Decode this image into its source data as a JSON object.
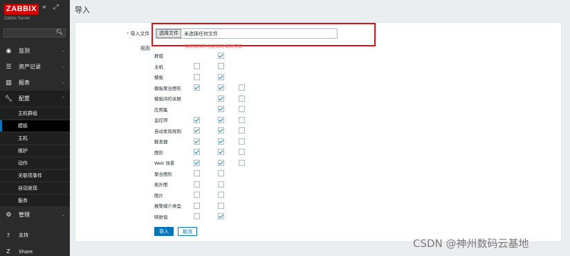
{
  "sidebar": {
    "logo": "ZABBIX",
    "collapse_icon": "«",
    "kiosk_icon": "⤢",
    "server_name": "Zabbix Server",
    "menu": [
      {
        "label": "监测",
        "icon": "eye-icon"
      },
      {
        "label": "资产记录",
        "icon": "list-icon"
      },
      {
        "label": "报表",
        "icon": "chart-icon"
      },
      {
        "label": "配置",
        "icon": "wrench-icon"
      }
    ],
    "submenu": [
      "主机群组",
      "模板",
      "主机",
      "维护",
      "动作",
      "关联项事件",
      "自动发现",
      "服务"
    ],
    "admin": {
      "label": "管理",
      "icon": "gear-icon"
    },
    "bottom": [
      {
        "label": "支持",
        "icon": "support-icon"
      },
      {
        "label": "Share",
        "icon": "share-icon"
      }
    ]
  },
  "page": {
    "title": "导入"
  },
  "form": {
    "import_file_label": "导入文件",
    "file_button": "选择文件",
    "file_status": "未选择任何文件",
    "rules_label": "规则",
    "column_headers": "更新现有的 创建新的 删除失败",
    "rules": [
      {
        "name": "群组",
        "cols": [
          null,
          true,
          null
        ]
      },
      {
        "name": "主机",
        "cols": [
          false,
          false,
          null
        ]
      },
      {
        "name": "模板",
        "cols": [
          false,
          true,
          null
        ]
      },
      {
        "name": "模板聚合图形",
        "cols": [
          true,
          true,
          false
        ]
      },
      {
        "name": "模板间的关联",
        "cols": [
          null,
          true,
          false
        ]
      },
      {
        "name": "应用集",
        "cols": [
          null,
          true,
          false
        ]
      },
      {
        "name": "监控项",
        "cols": [
          true,
          true,
          false
        ]
      },
      {
        "name": "自动发现规则",
        "cols": [
          true,
          true,
          false
        ]
      },
      {
        "name": "触发器",
        "cols": [
          true,
          true,
          false
        ]
      },
      {
        "name": "图形",
        "cols": [
          true,
          true,
          false
        ]
      },
      {
        "name": "Web 场景",
        "cols": [
          true,
          true,
          false
        ]
      },
      {
        "name": "聚合图形",
        "cols": [
          false,
          false,
          null
        ]
      },
      {
        "name": "拓扑图",
        "cols": [
          false,
          false,
          null
        ]
      },
      {
        "name": "图片",
        "cols": [
          false,
          false,
          null
        ]
      },
      {
        "name": "报警媒介类型",
        "cols": [
          false,
          false,
          null
        ]
      },
      {
        "name": "映射值",
        "cols": [
          false,
          true,
          null
        ]
      }
    ],
    "import_button": "导入",
    "cancel_button": "取消"
  },
  "watermark": "CSDN @神州数码云基地",
  "colors": {
    "accent": "#0275b8",
    "logo": "#d40000",
    "highlight": "#e01010"
  }
}
